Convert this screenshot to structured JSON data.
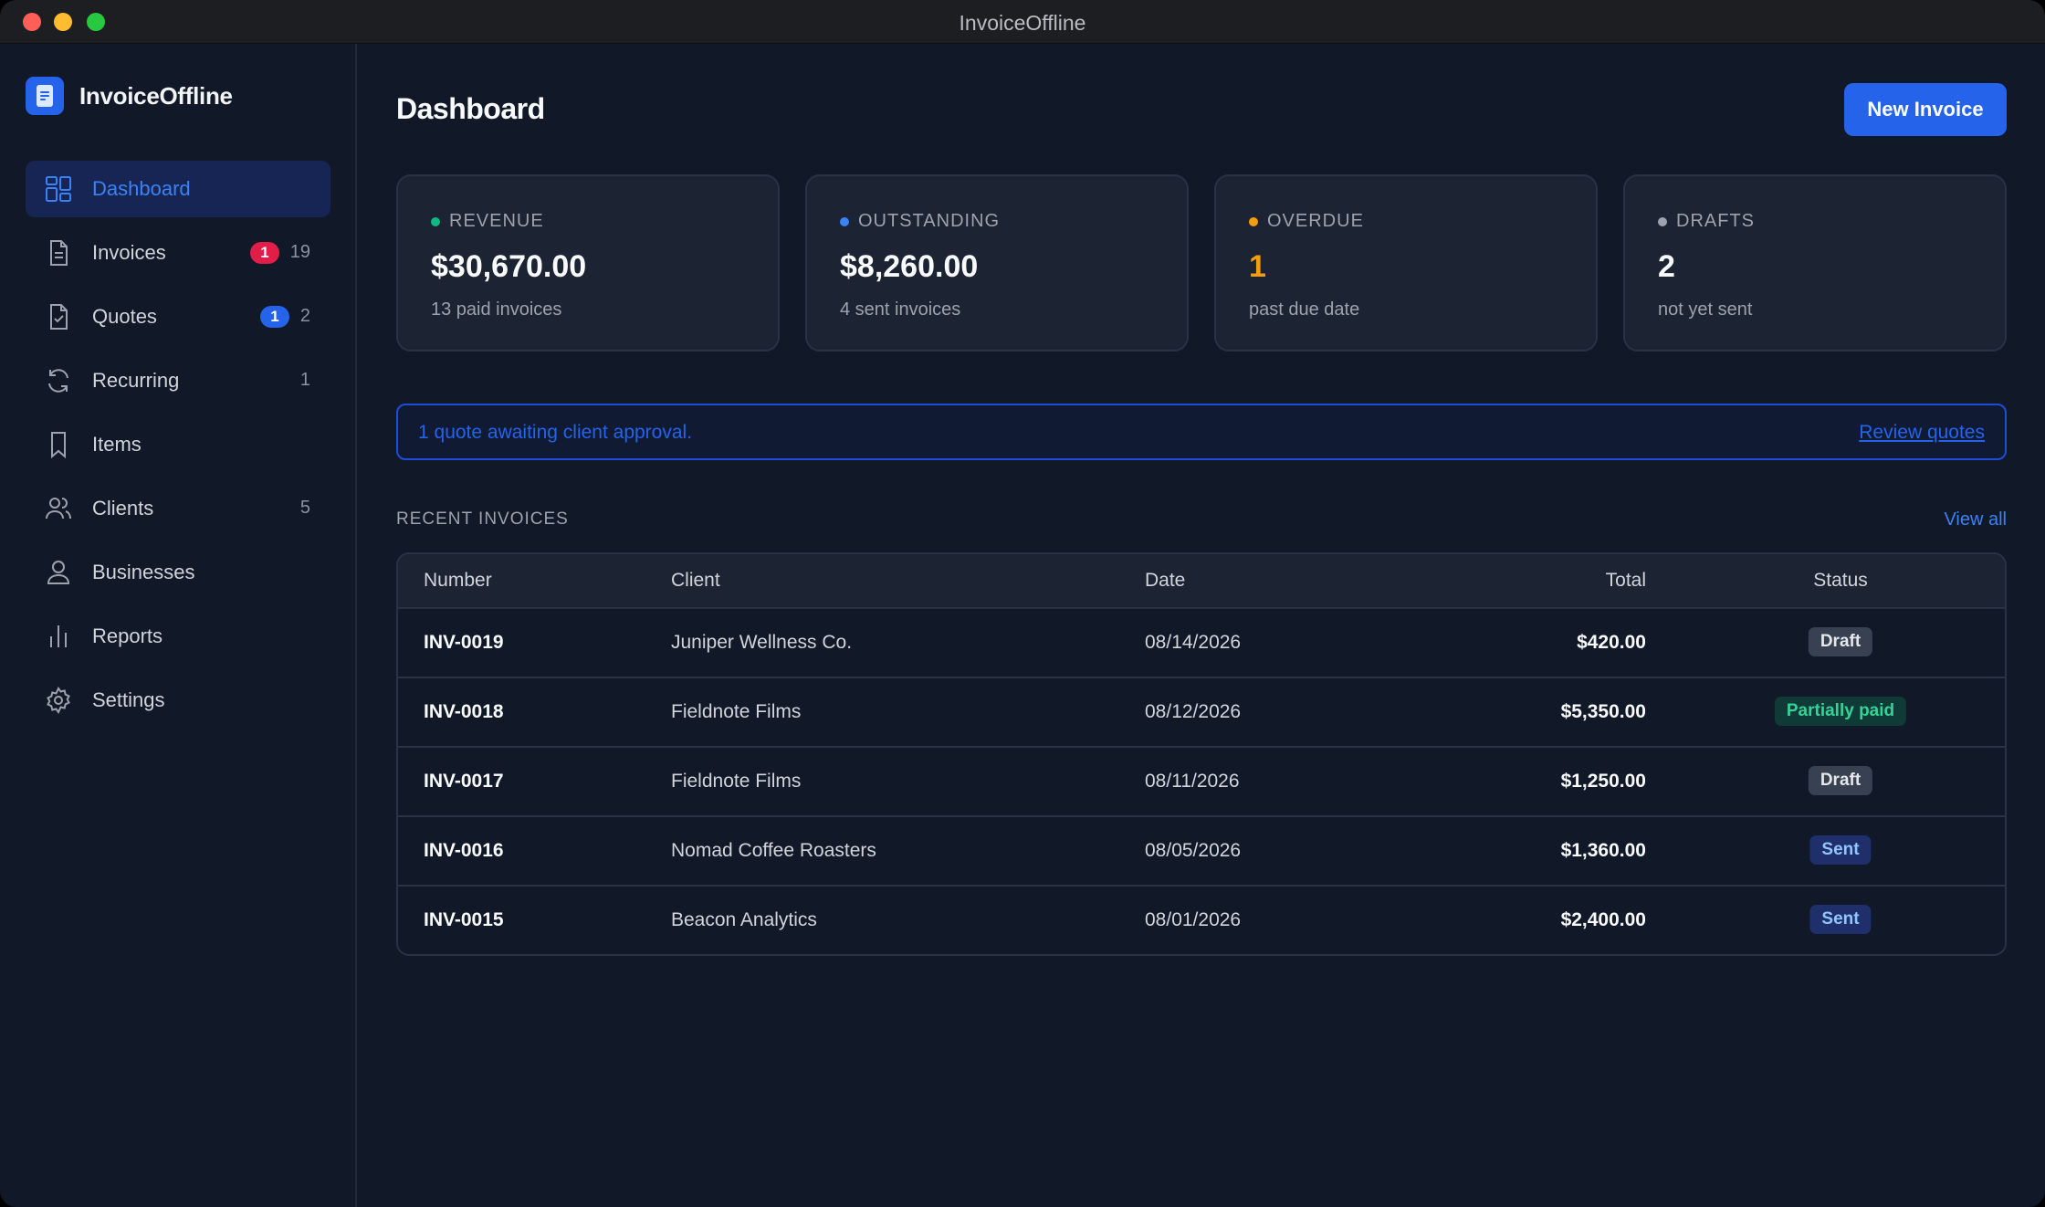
{
  "window": {
    "title": "InvoiceOffline"
  },
  "app": {
    "name": "InvoiceOffline"
  },
  "sidebar": {
    "items": [
      {
        "label": "Dashboard",
        "icon": "dashboard-icon",
        "active": true
      },
      {
        "label": "Invoices",
        "icon": "document-icon",
        "badge": "1",
        "count": "19"
      },
      {
        "label": "Quotes",
        "icon": "document-check-icon",
        "badge": "1",
        "count": "2"
      },
      {
        "label": "Recurring",
        "icon": "refresh-icon",
        "count": "1"
      },
      {
        "label": "Items",
        "icon": "bookmark-icon"
      },
      {
        "label": "Clients",
        "icon": "users-icon",
        "count": "5"
      },
      {
        "label": "Businesses",
        "icon": "user-icon"
      },
      {
        "label": "Reports",
        "icon": "bar-chart-icon"
      },
      {
        "label": "Settings",
        "icon": "gear-icon"
      }
    ]
  },
  "header": {
    "title": "Dashboard",
    "new_invoice_label": "New Invoice"
  },
  "stats": [
    {
      "label": "REVENUE",
      "value": "$30,670.00",
      "sub": "13 paid invoices",
      "dot_color": "#10b981"
    },
    {
      "label": "OUTSTANDING",
      "value": "$8,260.00",
      "sub": "4 sent invoices",
      "dot_color": "#3b82f6"
    },
    {
      "label": "OVERDUE",
      "value": "1",
      "sub": "past due date",
      "dot_color": "#f59e0b"
    },
    {
      "label": "DRAFTS",
      "value": "2",
      "sub": "not yet sent",
      "dot_color": "#9ca3af"
    }
  ],
  "alert": {
    "text": "1 quote awaiting client approval.",
    "link": "Review quotes"
  },
  "recent": {
    "title": "RECENT INVOICES",
    "view_all": "View all",
    "columns": [
      "Number",
      "Client",
      "Date",
      "Total",
      "Status"
    ],
    "rows": [
      {
        "number": "INV-0019",
        "client": "Juniper Wellness Co.",
        "date": "08/14/2026",
        "total": "$420.00",
        "status": "Draft"
      },
      {
        "number": "INV-0018",
        "client": "Fieldnote Films",
        "date": "08/12/2026",
        "total": "$5,350.00",
        "status": "Partially paid"
      },
      {
        "number": "INV-0017",
        "client": "Fieldnote Films",
        "date": "08/11/2026",
        "total": "$1,250.00",
        "status": "Draft"
      },
      {
        "number": "INV-0016",
        "client": "Nomad Coffee Roasters",
        "date": "08/05/2026",
        "total": "$1,360.00",
        "status": "Sent"
      },
      {
        "number": "INV-0015",
        "client": "Beacon Analytics",
        "date": "08/01/2026",
        "total": "$2,400.00",
        "status": "Sent"
      }
    ]
  },
  "colors": {
    "accent": "#2563eb",
    "overdue": "#f59e0b",
    "badge_red": "#e11d48"
  }
}
